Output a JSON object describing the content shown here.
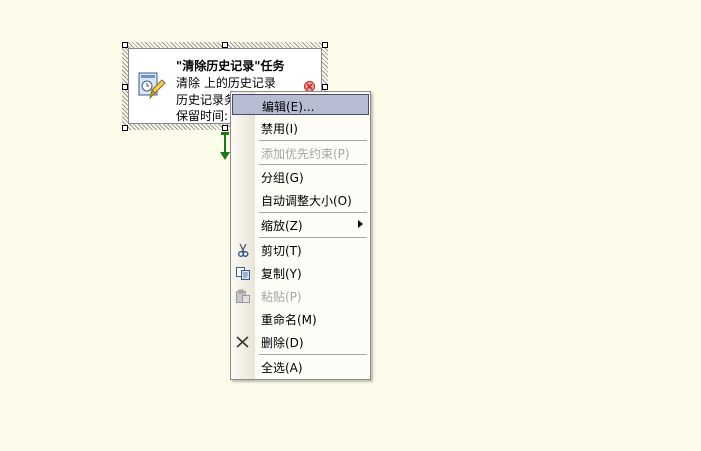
{
  "task": {
    "title": "\"清除历史记录\"任务",
    "line1": "清除 上的历史记录",
    "line2": "历史记录务",
    "line3": "保留时间:"
  },
  "menu": {
    "items": [
      {
        "label": "编辑(E)...",
        "state": "selected",
        "icon": ""
      },
      {
        "label": "禁用(I)",
        "state": "normal",
        "icon": ""
      },
      {
        "label": "添加优先约束(P)",
        "state": "disabled",
        "icon": ""
      },
      {
        "label": "分组(G)",
        "state": "normal",
        "icon": ""
      },
      {
        "label": "自动调整大小(O)",
        "state": "normal",
        "icon": ""
      },
      {
        "label": "缩放(Z)",
        "state": "normal",
        "icon": "",
        "submenu": true
      },
      {
        "label": "剪切(T)",
        "state": "normal",
        "icon": "scissors-icon"
      },
      {
        "label": "复制(Y)",
        "state": "normal",
        "icon": "copy-icon"
      },
      {
        "label": "粘贴(P)",
        "state": "disabled",
        "icon": "paste-icon"
      },
      {
        "label": "重命名(M)",
        "state": "normal",
        "icon": ""
      },
      {
        "label": "删除(D)",
        "state": "normal",
        "icon": "delete-x-icon"
      },
      {
        "label": "全选(A)",
        "state": "normal",
        "icon": ""
      }
    ]
  },
  "colors": {
    "background": "#fdfbe9",
    "selection": "#b6bdd2",
    "connector": "#1a7a1a"
  }
}
